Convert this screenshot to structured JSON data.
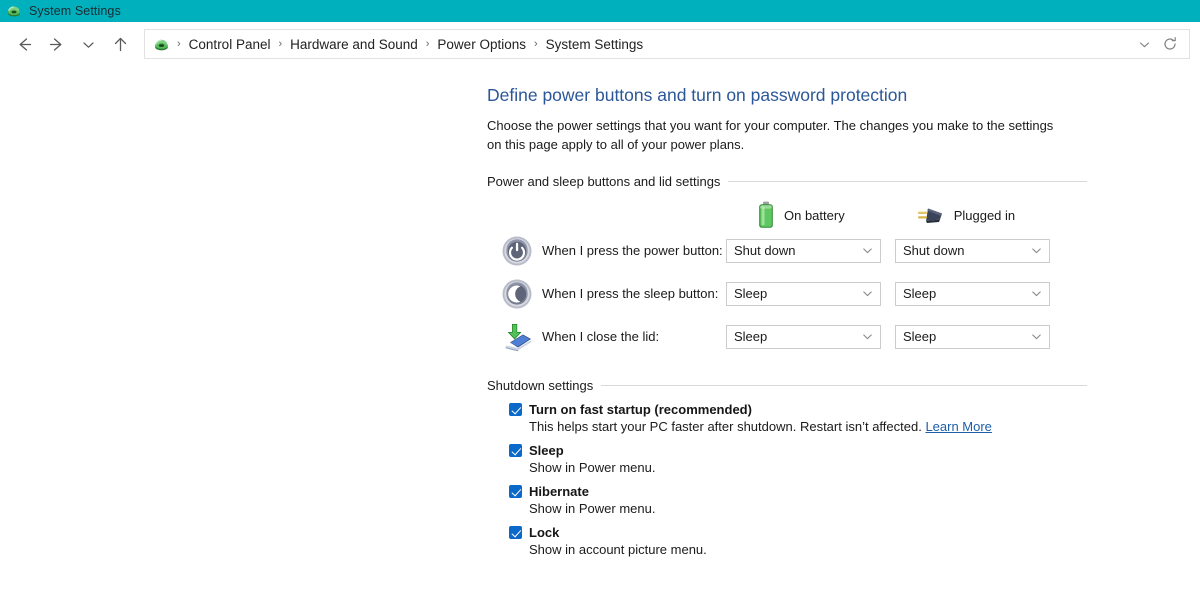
{
  "window": {
    "title": "System Settings",
    "icon": "control-panel-icon",
    "titlebar_color": "#00b0bc"
  },
  "nav": {
    "back_icon": "back-arrow-icon",
    "forward_icon": "forward-arrow-icon",
    "history_icon": "chevron-down-icon",
    "up_icon": "up-arrow-icon",
    "breadcrumb_icon": "control-panel-icon",
    "breadcrumb": [
      "Control Panel",
      "Hardware and Sound",
      "Power Options",
      "System Settings"
    ],
    "separator": "›",
    "dropdown_icon": "chevron-down-icon",
    "refresh_icon": "refresh-icon"
  },
  "page": {
    "title": "Define power buttons and turn on password protection",
    "title_color": "#2b5797",
    "description": "Choose the power settings that you want for your computer. The changes you make to the settings on this page apply to all of your power plans."
  },
  "power_group": {
    "heading": "Power and sleep buttons and lid settings",
    "columns": [
      {
        "label": "On battery",
        "icon": "battery-icon"
      },
      {
        "label": "Plugged in",
        "icon": "power-plug-icon"
      }
    ],
    "rows": [
      {
        "icon": "power-button-icon",
        "label": "When I press the power button:",
        "on_battery": "Shut down",
        "plugged_in": "Shut down"
      },
      {
        "icon": "sleep-button-icon",
        "label": "When I press the sleep button:",
        "on_battery": "Sleep",
        "plugged_in": "Sleep"
      },
      {
        "icon": "laptop-lid-icon",
        "label": "When I close the lid:",
        "on_battery": "Sleep",
        "plugged_in": "Sleep"
      }
    ]
  },
  "shutdown_group": {
    "heading": "Shutdown settings",
    "checkbox_color": "#0a69c9",
    "items": [
      {
        "label": "Turn on fast startup (recommended)",
        "checked": true,
        "description": "This helps start your PC faster after shutdown. Restart isn’t affected. ",
        "link": "Learn More"
      },
      {
        "label": "Sleep",
        "checked": true,
        "description": "Show in Power menu.",
        "link": ""
      },
      {
        "label": "Hibernate",
        "checked": true,
        "description": "Show in Power menu.",
        "link": ""
      },
      {
        "label": "Lock",
        "checked": true,
        "description": "Show in account picture menu.",
        "link": ""
      }
    ]
  }
}
